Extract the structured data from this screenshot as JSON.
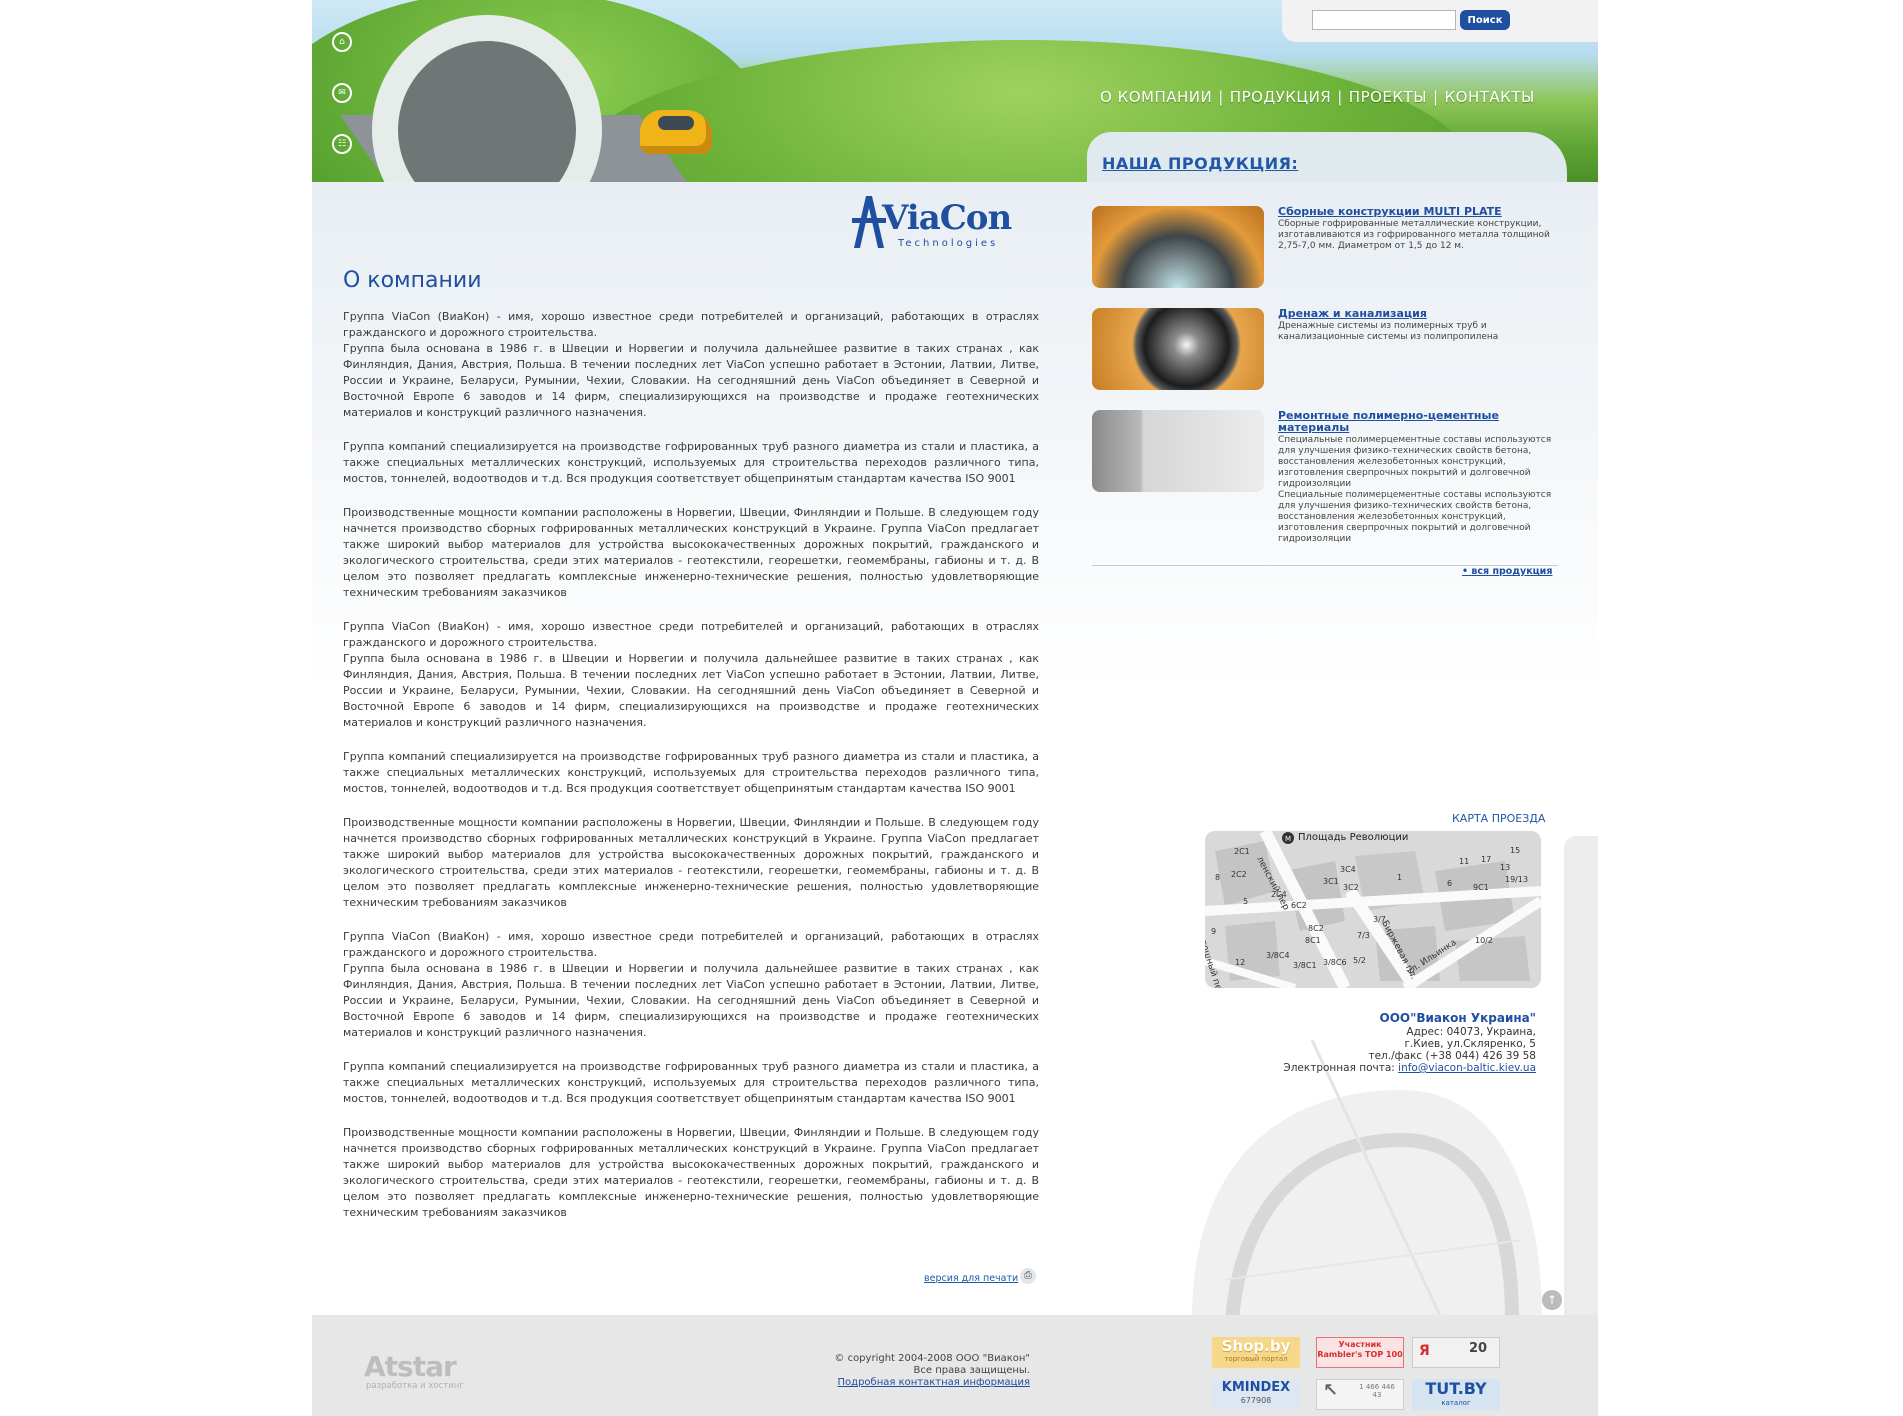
{
  "header": {
    "search": {
      "placeholder": "",
      "button_label": "Поиск"
    },
    "nav": [
      "О КОМПАНИИ",
      "ПРОДУКЦИЯ",
      "ПРОЕКТЫ",
      "КОНТАКТЫ"
    ],
    "nav_separator": "|",
    "side_icons": [
      "home-icon",
      "mail-icon",
      "sitemap-icon"
    ],
    "products_tab_title": "НАША ПРОДУКЦИЯ:"
  },
  "logo": {
    "text": "ViaCon",
    "subtitle": "Technologies"
  },
  "about": {
    "title": "О компании",
    "paragraphs": [
      "Группа ViaCon (ВиаКон) - имя, хорошо известное среди потребителей и организаций, работающих в отраслях гражданского и дорожного строительства.\nГруппа была основана в 1986 г. в Швеции и Норвегии и получила дальнейшее развитие в таких странах , как Финляндия, Дания, Австрия, Польша. В течении последних лет ViaCon успешно работает в Эстонии, Латвии, Литве, России и Украине, Беларуси, Румынии, Чехии, Словакии. На сегодняшний день ViaCon объединяет в Северной и Восточной Европе 6 заводов и 14 фирм, специализирующихся на производстве и продаже геотехнических материалов и конструкций различного назначения.",
      "Группа компаний специализируется на производстве гофрированных труб разного диаметра из стали и пластика, а также специальных металлических конструкций, используемых для строительства переходов различного типа, мостов, тоннелей, водоотводов и т.д. Вся продукция соответствует общепринятым стандартам качества ISO 9001",
      "Производственные мощности компании расположены в Норвегии, Швеции, Финляндии и Польше. В следующем году начнется производство сборных гофрированных металлических конструкций в Украине. Группа ViaCon предлагает также широкий выбор материалов для устройства высококачественных дорожных покрытий, гражданского и экологического строительства, среди этих материалов - геотекстили, георешетки, геомембраны, габионы и т. д. В целом это позволяет предлагать комплексные инженерно-технические решения, полностью удовлетворяющие техническим требованиям заказчиков",
      "Группа ViaCon (ВиаКон) - имя, хорошо известное среди потребителей и организаций, работающих в отраслях гражданского и дорожного строительства.\nГруппа была основана в 1986 г. в Швеции и Норвегии и получила дальнейшее развитие в таких странах , как Финляндия, Дания, Австрия, Польша. В течении последних лет ViaCon успешно работает в Эстонии, Латвии, Литве, России и Украине, Беларуси, Румынии, Чехии, Словакии. На сегодняшний день ViaCon объединяет в Северной и Восточной Европе 6 заводов и 14 фирм, специализирующихся на производстве и продаже геотехнических материалов и конструкций различного назначения.",
      "Группа компаний специализируется на производстве гофрированных труб разного диаметра из стали и пластика, а также специальных металлических конструкций, используемых для строительства переходов различного типа, мостов, тоннелей, водоотводов и т.д. Вся продукция соответствует общепринятым стандартам качества ISO 9001",
      "Производственные мощности компании расположены в Норвегии, Швеции, Финляндии и Польше. В следующем году начнется производство сборных гофрированных металлических конструкций в Украине. Группа ViaCon предлагает также широкий выбор материалов для устройства высококачественных дорожных покрытий, гражданского и экологического строительства, среди этих материалов - геотекстили, георешетки, геомембраны, габионы и т. д. В целом это позволяет предлагать комплексные инженерно-технические решения, полностью удовлетворяющие техническим требованиям заказчиков",
      "Группа ViaCon (ВиаКон) - имя, хорошо известное среди потребителей и организаций, работающих в отраслях гражданского и дорожного строительства.\nГруппа была основана в 1986 г. в Швеции и Норвегии и получила дальнейшее развитие в таких странах , как Финляндия, Дания, Австрия, Польша. В течении последних лет ViaCon успешно работает в Эстонии, Латвии, Литве, России и Украине, Беларуси, Румынии, Чехии, Словакии. На сегодняшний день ViaCon объединяет в Северной и Восточной Европе 6 заводов и 14 фирм, специализирующихся на производстве и продаже геотехнических материалов и конструкций различного назначения.",
      "Группа компаний специализируется на производстве гофрированных труб разного диаметра из стали и пластика, а также специальных металлических конструкций, используемых для строительства переходов различного типа, мостов, тоннелей, водоотводов и т.д. Вся продукция соответствует общепринятым стандартам качества ISO 9001",
      "Производственные мощности компании расположены в Норвегии, Швеции, Финляндии и Польше. В следующем году начнется производство сборных гофрированных металлических конструкций в Украине. Группа ViaCon предлагает также широкий выбор материалов для устройства высококачественных дорожных покрытий, гражданского и экологического строительства, среди этих материалов - геотекстили, георешетки, геомембраны, габионы и т. д. В целом это позволяет предлагать комплексные инженерно-технические решения, полностью удовлетворяющие техническим требованиям заказчиков"
    ],
    "print_link": "версия для печати"
  },
  "products": {
    "items": [
      {
        "title": "Сборные конструкции MULTI PLATE",
        "desc": "Сборные гофрированные металлические конструкции, изготавливаются из гофрированного металла толщиной 2,75-7,0 мм. Диаметром от 1,5 до 12 м."
      },
      {
        "title": "Дренаж и канализация",
        "desc": "Дренажные системы из полимерных труб и канализационные системы из полипропилена"
      },
      {
        "title": "Ремонтные полимерно-цементные материалы",
        "desc": "Специальные полимерцементные составы используются для улучшения физико-технических свойств бетона, восстановления железобетонных конструкций, изготовления сверпрочных покрытий и долговечной гидроизоляции\nСпециальные полимерцементные составы используются для улучшения физико-технических свойств бетона, восстановления железобетонных конструкций, изготовления сверпрочных покрытий и долговечной гидроизоляции"
      }
    ],
    "all_link": "вся продукция"
  },
  "map": {
    "title": "КАРТА ПРОЕЗДА",
    "metro_label": "Площадь Революции",
    "streets": [
      "пр",
      "ленский пер",
      "Биржевая пл.",
      "ул. Ильинка",
      "тошный пер"
    ],
    "labels": [
      "2С1",
      "2С2",
      "2С4",
      "6С2",
      "3С1",
      "3С4",
      "3С2",
      "8С2",
      "8С1",
      "7/3",
      "3/7",
      "10/2",
      "3/8С1",
      "3/8С6",
      "3/8С4",
      "5/2",
      "17",
      "13",
      "15",
      "19/13",
      "9С1",
      "6",
      "11",
      "1",
      "5",
      "9",
      "12",
      "8"
    ]
  },
  "company": {
    "name": "ООО\"Виакон Украина\"",
    "address_line1": "Адрес: 04073, Украина,",
    "address_line2": "г.Киев, ул.Скляренко, 5",
    "phone": "тел./факс (+38 044) 426 39 58",
    "email_label": "Электронная почта:",
    "email": "info@viacon-baltic.kiev.ua"
  },
  "footer": {
    "developer_logo": "Atstar",
    "developer_sub": "разработка и хостинг",
    "copyright": "© copyright 2004-2008 ООО \"Виакон\"",
    "rights": "Все права защищены.",
    "contact_link": "Подробная контактная информация",
    "counters": [
      {
        "text": "Shop.by",
        "sub": "торговый портал"
      },
      {
        "text": "Участник Rambler's TOP 100",
        "sub": ""
      },
      {
        "text": "Я",
        "sub": "20"
      },
      {
        "text": "KMINDEX",
        "sub": "677908"
      },
      {
        "text": "1 466 446 43",
        "sub": ""
      },
      {
        "text": "TUT.BY",
        "sub": "каталог"
      }
    ]
  },
  "colors": {
    "accent": "#1f4fa0",
    "link": "#2057a8",
    "footer_bg": "#e7e7e7"
  }
}
